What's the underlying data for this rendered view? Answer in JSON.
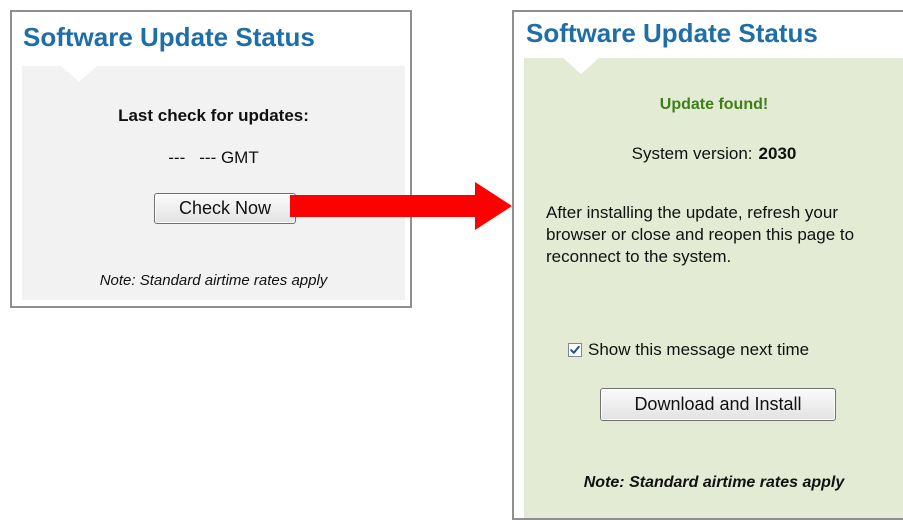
{
  "left_panel": {
    "title": "Software Update Status",
    "last_check_label": "Last check for updates:",
    "last_check_date": "---",
    "last_check_time": "--- GMT",
    "check_button": "Check Now",
    "note": "Note: Standard airtime rates apply"
  },
  "right_panel": {
    "title": "Software Update Status",
    "status": "Update found!",
    "version_label": "System version:",
    "version_value": "2030",
    "instructions": "After installing the update, refresh your browser or close and reopen this page to reconnect to the system.",
    "checkbox_label": "Show this message next time",
    "checkbox_checked": true,
    "install_button": "Download and Install",
    "note": "Note: Standard airtime rates apply"
  },
  "colors": {
    "title": "#1f6ea8",
    "status_green": "#3f7f18",
    "arrow_red": "#ff0000",
    "left_body_bg": "#f2f2f2",
    "right_body_bg": "#e3ebd4"
  },
  "icons": {
    "arrow": "arrow-right-icon",
    "checkbox": "checkmark-icon"
  }
}
